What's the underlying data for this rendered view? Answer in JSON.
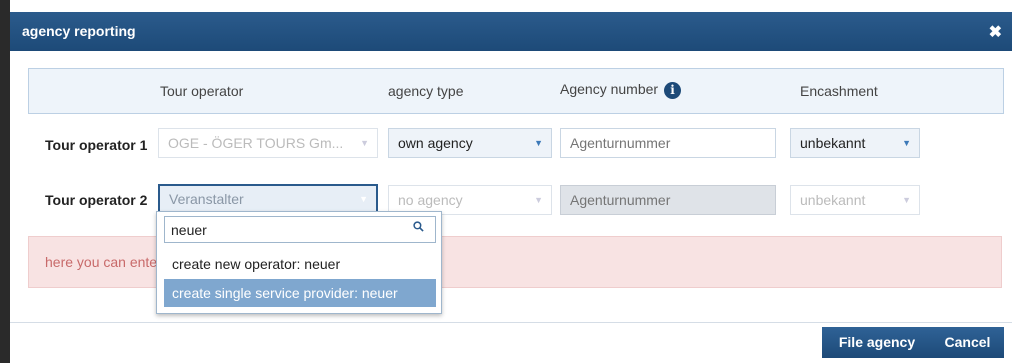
{
  "dialog": {
    "title": "agency reporting",
    "close_icon": "close-icon"
  },
  "columns": {
    "tour_operator": "Tour operator",
    "agency_type": "agency type",
    "agency_number": "Agency number",
    "encashment": "Encashment",
    "info_icon_glyph": "i"
  },
  "rows": [
    {
      "label": "Tour operator 1",
      "operator": "OGE - ÖGER TOURS Gm...",
      "agency_type": "own agency",
      "agency_number_placeholder": "Agenturnummer",
      "encashment": "unbekannt"
    },
    {
      "label": "Tour operator 2",
      "operator": "Veranstalter",
      "agency_type": "no agency",
      "agency_number_placeholder": "Agenturnummer",
      "encashment": "unbekannt"
    }
  ],
  "notice": {
    "text": "here you can ente"
  },
  "dropdown": {
    "search_value": "neuer",
    "items": [
      "create new operator: neuer",
      "create single service provider: neuer"
    ]
  },
  "buttons": {
    "file_agency": "File agency",
    "cancel": "Cancel"
  },
  "colors": {
    "brand_blue": "#1d4a78",
    "header_bg": "#eef4fa",
    "notice_bg": "#f8e3e3",
    "highlight": "#7fa7cf"
  }
}
